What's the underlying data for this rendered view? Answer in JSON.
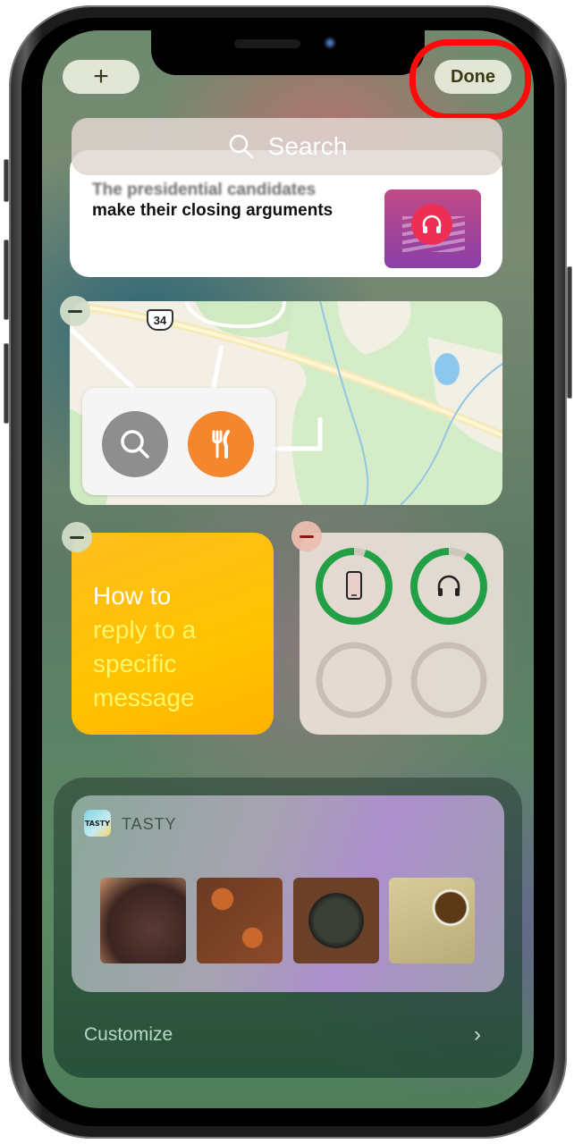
{
  "header": {
    "add_label": "+",
    "done_label": "Done"
  },
  "search": {
    "placeholder": "Search",
    "icon": "search-icon"
  },
  "news_widget": {
    "faded_line": "The presidential candidates",
    "title_line": "make their closing arguments",
    "thumbnail_icon": "headphones-icon"
  },
  "maps_widget": {
    "route_shield": "34",
    "buttons": [
      {
        "icon": "search-icon",
        "color": "#8e8e8e"
      },
      {
        "icon": "fork-knife-icon",
        "color": "#f4862d"
      }
    ]
  },
  "tips_widget": {
    "line1": "How to",
    "line2": "reply to a",
    "line3": "specific",
    "line4": "message",
    "bg_color": "#ffc300"
  },
  "batteries_widget": {
    "devices": [
      {
        "icon": "iphone-icon",
        "level": 0.95
      },
      {
        "icon": "headphones-icon",
        "level": 0.92
      },
      {
        "icon": "",
        "level": 0
      },
      {
        "icon": "",
        "level": 0
      }
    ],
    "ring_color": "#22a045"
  },
  "tasty_widget": {
    "app_name": "TASTY",
    "app_icon_text": "TASTY",
    "thumbnails": [
      "chocolate-bark",
      "curry-bowls",
      "paella-skillet",
      "dumplings"
    ]
  },
  "stack_footer": {
    "customize_label": "Customize",
    "chevron": "›"
  },
  "accent": {
    "highlight_ring": "#ff0a0a"
  }
}
